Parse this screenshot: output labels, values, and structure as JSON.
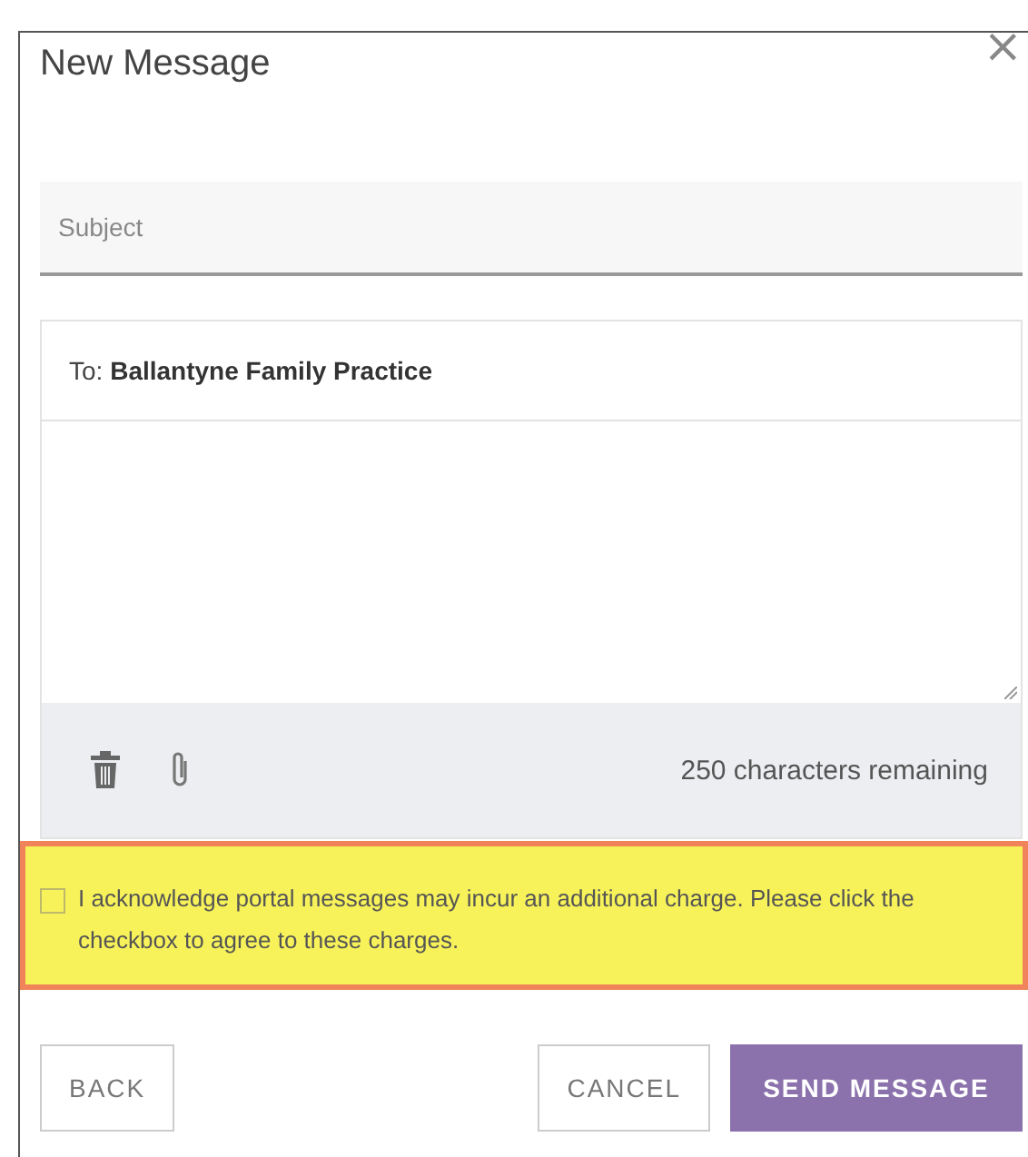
{
  "dialog": {
    "title": "New Message",
    "close": "×"
  },
  "subject": {
    "placeholder": "Subject"
  },
  "message": {
    "to_label": "To:",
    "recipient": "Ballantyne Family Practice"
  },
  "toolbar": {
    "counter": "250 characters remaining"
  },
  "acknowledgement": {
    "checked": false,
    "text": "I acknowledge portal messages may incur an additional charge. Please click the checkbox to agree to these charges."
  },
  "buttons": [
    {
      "label": "BACK",
      "kind": "outline"
    },
    {
      "label": "CANCEL",
      "kind": "outline"
    },
    {
      "label": "SEND MESSAGE",
      "kind": "primary"
    }
  ]
}
